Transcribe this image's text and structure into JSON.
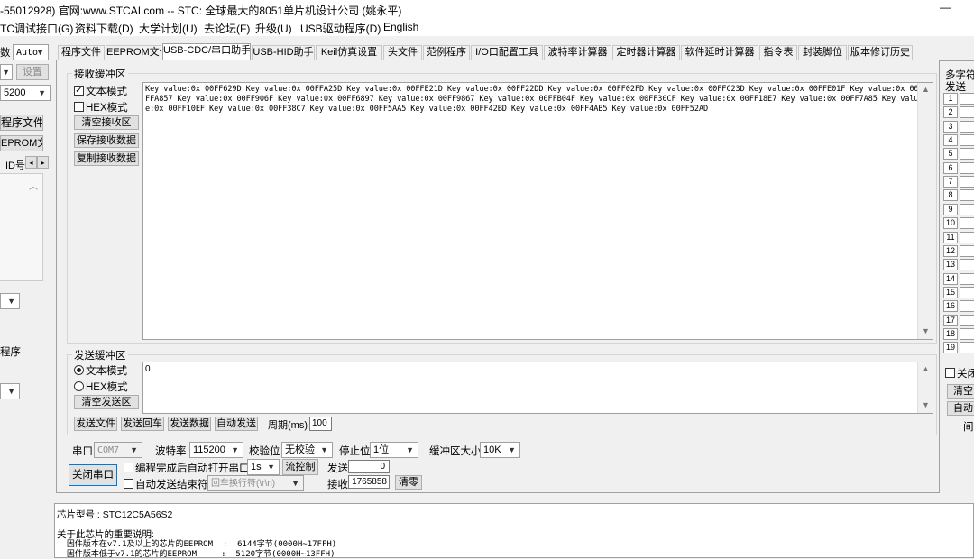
{
  "title_bar": {
    "text": "-55012928) 官网:www.STCAI.com  -- STC: 全球最大的8051单片机设计公司 (姚永平)",
    "minimize": "—"
  },
  "menu": [
    "TC调试接口(G)",
    "资料下载(D)",
    "大学计划(U)",
    "去论坛(F)",
    "升级(U)",
    "USB驱动程序(D)",
    "English"
  ],
  "left_panel": {
    "label_shu": "数",
    "mode_select": "Auto",
    "settings_button": "设置",
    "baud_select": "5200",
    "open_prog_button": "程序文件",
    "open_eeprom_button": "EPROM文件",
    "id_label": "ID号",
    "label_chengxu": "程序"
  },
  "tabs": [
    "程序文件",
    "EEPROM文件",
    "USB-CDC/串口助手",
    "USB-HID助手",
    "Keil仿真设置",
    "头文件",
    "范例程序",
    "I/O口配置工具",
    "波特率计算器",
    "定时器计算器",
    "软件延时计算器",
    "指令表",
    "封装脚位",
    "版本修订历史"
  ],
  "active_tab": "USB-CDC/串口助手",
  "receive": {
    "group_title": "接收缓冲区",
    "text_mode_label": "文本模式",
    "text_mode_checked": true,
    "hex_mode_label": "HEX模式",
    "hex_mode_checked": false,
    "clear_button": "清空接收区",
    "save_button": "保存接收数据",
    "copy_button": "复制接收数据",
    "content": "Key value:0x 00FF629D    Key value:0x 00FFA25D    Key value:0x 00FFE21D    Key value:0x 00FF22DD    Key value:0x 00FF02FD    Key value:0x 00FFC23D    Key value:0x 00FFE01F    Key value:0x 00FFA857    Key value:0x 00FF906F    Key value:0x 00FF6897    Key value:0x 00FF9867    Key value:0x 00FFB04F    Key value:0x 00FF30CF    Key value:0x 00FF18E7    Key value:0x 00FF7A85    Key value:0x 00FF10EF    Key value:0x 00FF38C7    Key value:0x 00FF5AA5    Key value:0x 00FF42BD    Key value:0x 00FF4AB5    Key value:0x 00FF52AD"
  },
  "send": {
    "group_title": "发送缓冲区",
    "text_mode_label": "文本模式",
    "hex_mode_label": "HEX模式",
    "selected_mode": "text",
    "clear_button": "清空发送区",
    "content": "0",
    "send_file_button": "发送文件",
    "send_enter_button": "发送回车",
    "send_data_button": "发送数据",
    "auto_send_button": "自动发送",
    "period_label": "周期(ms)",
    "period_value": "100"
  },
  "serial": {
    "port_label": "串口",
    "port_value": "COM7",
    "baud_label": "波特率",
    "baud_value": "115200",
    "parity_label": "校验位",
    "parity_value": "无校验",
    "stop_label": "停止位",
    "stop_value": "1位",
    "buffer_label": "缓冲区大小",
    "buffer_value": "10K",
    "close_button": "关闭串口",
    "auto_open_label": "编程完成后自动打开串口",
    "auto_open_value": "1s",
    "flow_button": "流控制",
    "send_end_label": "自动发送结束符",
    "send_end_value": "回车换行符(\\r\\n)",
    "send_count_label": "发送",
    "send_count": "0",
    "recv_count_label": "接收",
    "recv_count": "1765858",
    "clear_count_button": "清零"
  },
  "right_panel": {
    "title": "多字符",
    "send_label": "发送",
    "rows": [
      "1",
      "2",
      "3",
      "4",
      "5",
      "6",
      "7",
      "8",
      "9",
      "10",
      "11",
      "12",
      "13",
      "14",
      "15",
      "16",
      "17",
      "18",
      "19"
    ],
    "close_label": "关闭",
    "clear_label": "清空",
    "auto_label": "自动",
    "interval_label": "间"
  },
  "info": {
    "chip_label": "芯片型号 : STC12C5A56S2",
    "note_title": "关于此芯片的重要说明:",
    "line1": "  固件版本在v7.1及以上的芯片的EEPROM  :  6144字节(0000H~17FFH)",
    "line2": "  固件版本低于v7.1的芯片的EEPROM     :  5120字节(0000H~13FFH)"
  }
}
